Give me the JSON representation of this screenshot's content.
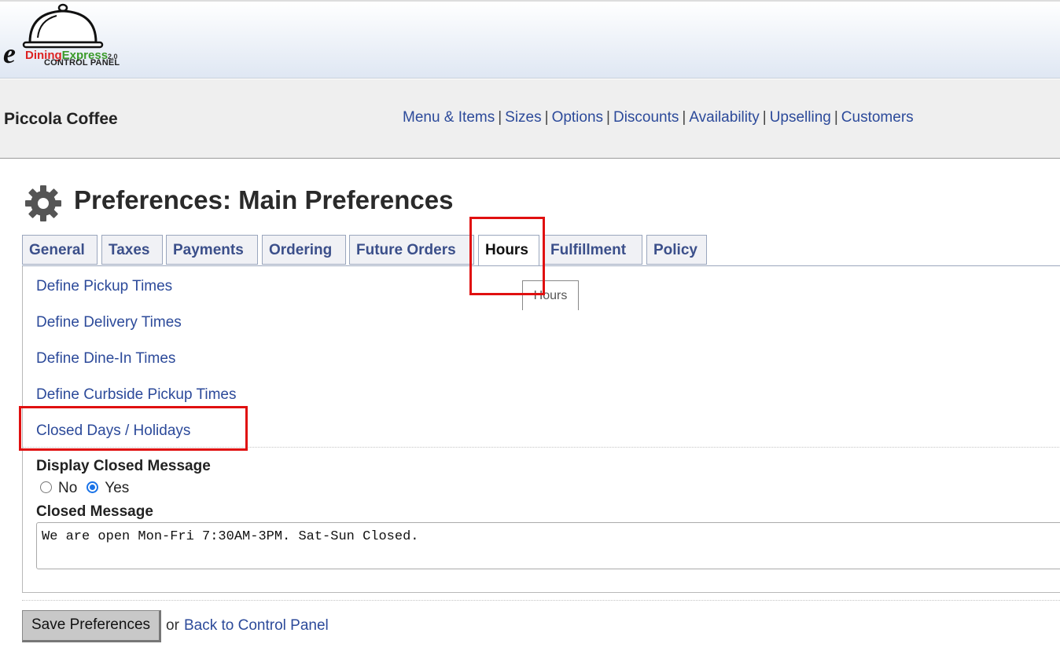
{
  "header": {
    "logo": {
      "letter": "e",
      "dining": "Dining",
      "express": "Express",
      "version": "2.0",
      "subtitle": "CONTROL PANEL"
    }
  },
  "store_name": "Piccola Coffee",
  "top_nav": [
    "Menu & Items",
    "Sizes",
    "Options",
    "Discounts",
    "Availability",
    "Upselling",
    "Customers"
  ],
  "top_nav_separator": "|",
  "page_title": "Preferences: Main Preferences",
  "tabs": [
    "General",
    "Taxes",
    "Payments",
    "Ordering",
    "Future Orders",
    "Hours",
    "Fulfillment",
    "Policy"
  ],
  "active_tab": "Hours",
  "tooltip": "Hours",
  "hours_links": [
    "Define Pickup Times",
    "Define Delivery Times",
    "Define Dine-In Times",
    "Define Curbside Pickup Times",
    "Closed Days / Holidays"
  ],
  "display_closed": {
    "label": "Display Closed Message",
    "options": [
      "No",
      "Yes"
    ],
    "selected": "Yes"
  },
  "closed_message": {
    "label": "Closed Message",
    "value": "We are open Mon-Fri 7:30AM-3PM. Sat-Sun Closed."
  },
  "footer": {
    "save_label": "Save Preferences",
    "or_text": "or",
    "back_label": "Back to Control Panel"
  },
  "colors": {
    "link": "#2c4a9a",
    "highlight": "#e01010",
    "radio_selected": "#1a73e8"
  }
}
